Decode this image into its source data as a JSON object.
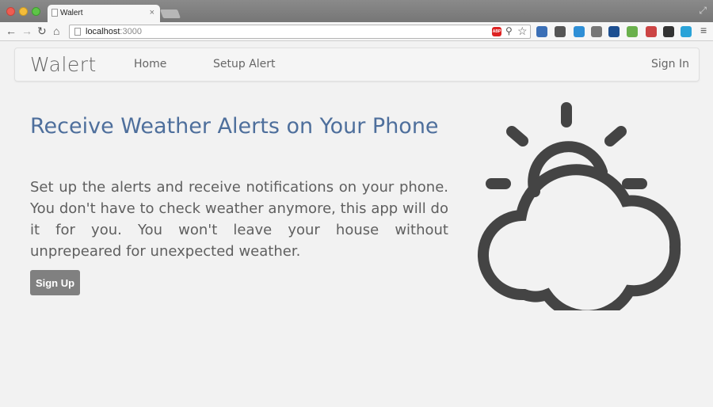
{
  "browser": {
    "tab_title": "Walert",
    "tab_close": "×",
    "url_host": "localhost",
    "url_port": ":3000",
    "abp_label": "ABP"
  },
  "navbar": {
    "brand": "Walert",
    "links": [
      "Home",
      "Setup Alert"
    ],
    "sign_in": "Sign In"
  },
  "hero": {
    "title": "Receive Weather Alerts on Your Phone",
    "text": "Set up the alerts and receive notifications on your phone. You don't have to check weather anymore, this app will do it for you. You won't leave your house without unprepeared for unexpected weather.",
    "cta": "Sign Up"
  },
  "icons": {
    "weather": "partly-cloudy-icon"
  },
  "colors": {
    "title": "#4e6f9c",
    "text": "#5f5f5f",
    "button": "#808080",
    "icon_stroke": "#444444"
  }
}
